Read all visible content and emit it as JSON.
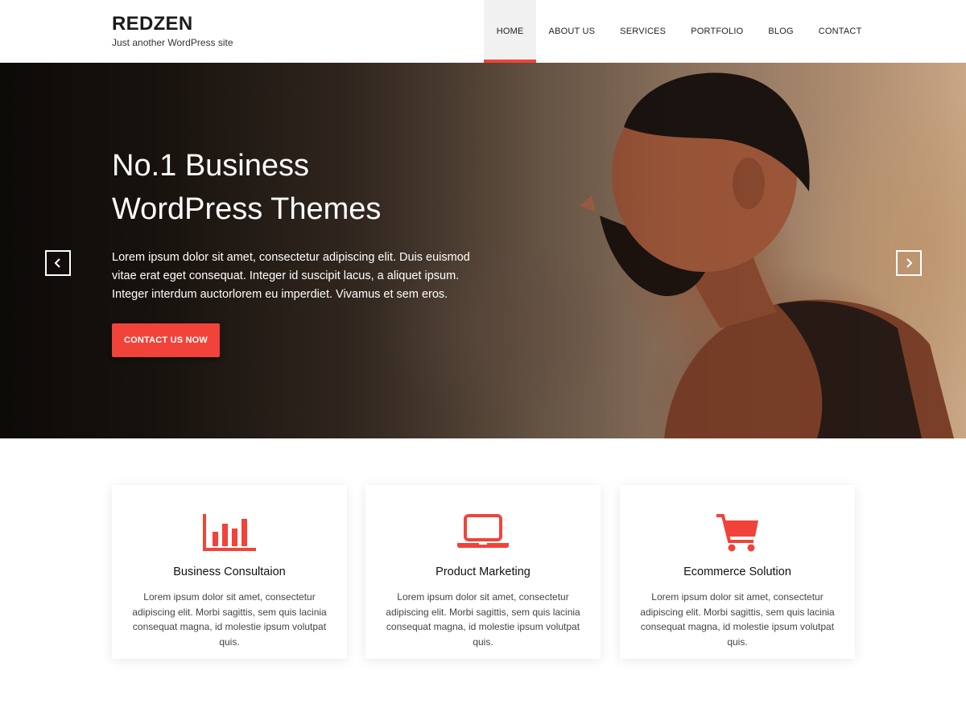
{
  "site": {
    "title": "REDZEN",
    "tagline": "Just another WordPress site"
  },
  "nav": {
    "items": [
      {
        "label": "HOME",
        "active": true
      },
      {
        "label": "ABOUT US",
        "active": false
      },
      {
        "label": "SERVICES",
        "active": false
      },
      {
        "label": "PORTFOLIO",
        "active": false
      },
      {
        "label": "BLOG",
        "active": false
      },
      {
        "label": "CONTACT",
        "active": false
      }
    ]
  },
  "hero": {
    "title_line1": "No.1 Business",
    "title_line2": "WordPress Themes",
    "text": "Lorem ipsum dolor sit amet, consectetur adipiscing elit. Duis euismod vitae erat eget consequat. Integer id suscipit lacus, a aliquet ipsum. Integer interdum auctorlorem eu imperdiet. Vivamus et sem eros.",
    "button_label": "CONTACT US NOW",
    "prev_icon": "chevron-left-icon",
    "next_icon": "chevron-right-icon"
  },
  "features": [
    {
      "icon": "bar-chart-icon",
      "title": "Business Consultaion",
      "text": "Lorem ipsum dolor sit amet, consectetur adipiscing elit. Morbi sagittis, sem quis lacinia consequat magna, id molestie ipsum volutpat quis."
    },
    {
      "icon": "laptop-icon",
      "title": "Product Marketing",
      "text": "Lorem ipsum dolor sit amet, consectetur adipiscing elit. Morbi sagittis, sem quis lacinia consequat magna, id molestie ipsum volutpat quis."
    },
    {
      "icon": "shopping-cart-icon",
      "title": "Ecommerce Solution",
      "text": "Lorem ipsum dolor sit amet, consectetur adipiscing elit. Morbi sagittis, sem quis lacinia consequat magna, id molestie ipsum volutpat quis."
    }
  ],
  "colors": {
    "accent": "#f1433a",
    "text_dark": "#1b1b1b"
  }
}
